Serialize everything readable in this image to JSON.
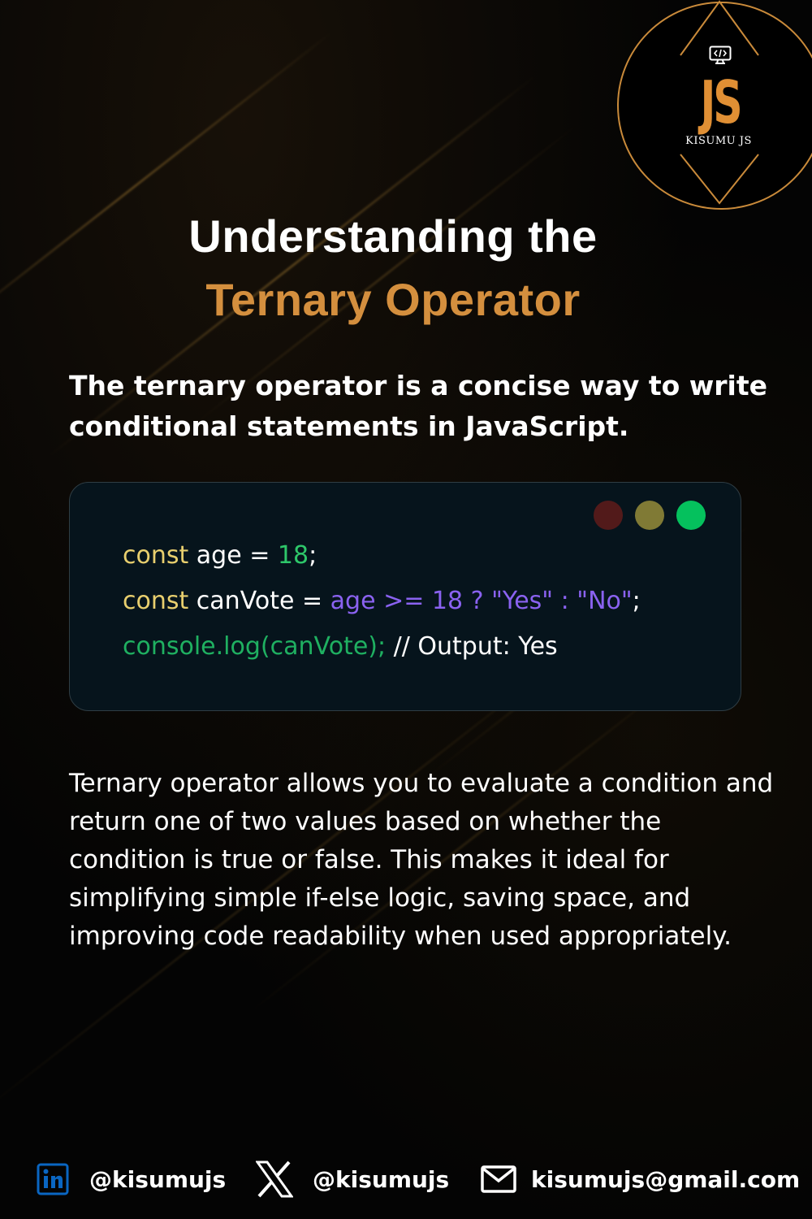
{
  "logo": {
    "mark": "JS",
    "name": "KISUMU JS",
    "icon": "monitor-code-icon",
    "accent_color": "#e08f34"
  },
  "title": {
    "line1": "Understanding the",
    "line2": "Ternary Operator",
    "line2_color": "#d48f3e"
  },
  "intro": "The ternary operator is a concise way to write conditional statements in JavaScript.",
  "code_window": {
    "window_dots": [
      "#521a1a",
      "#807a35",
      "#05c15d"
    ],
    "lines": [
      {
        "kw": "const",
        "rest": " age = ",
        "num": "18",
        "end": ";"
      },
      {
        "kw": "const",
        "rest": " canVote = ",
        "expr": "age >= 18 ? \"Yes\" : \"No\"",
        "end": ";"
      },
      {
        "call": "console.log(canVote);",
        "comment": " // Output: Yes"
      }
    ]
  },
  "body": "Ternary operator allows you to evaluate a condition and return one of two values based on whether the condition is true or false. This makes it ideal for simplifying simple if-else logic, saving space, and improving code readability when used appropriately.",
  "footer": {
    "linkedin": {
      "icon": "linkedin-icon",
      "handle": "@kisumujs"
    },
    "x": {
      "icon": "x-icon",
      "handle": "@kisumujs"
    },
    "email": {
      "icon": "mail-icon",
      "address": "kisumujs@gmail.com"
    }
  }
}
